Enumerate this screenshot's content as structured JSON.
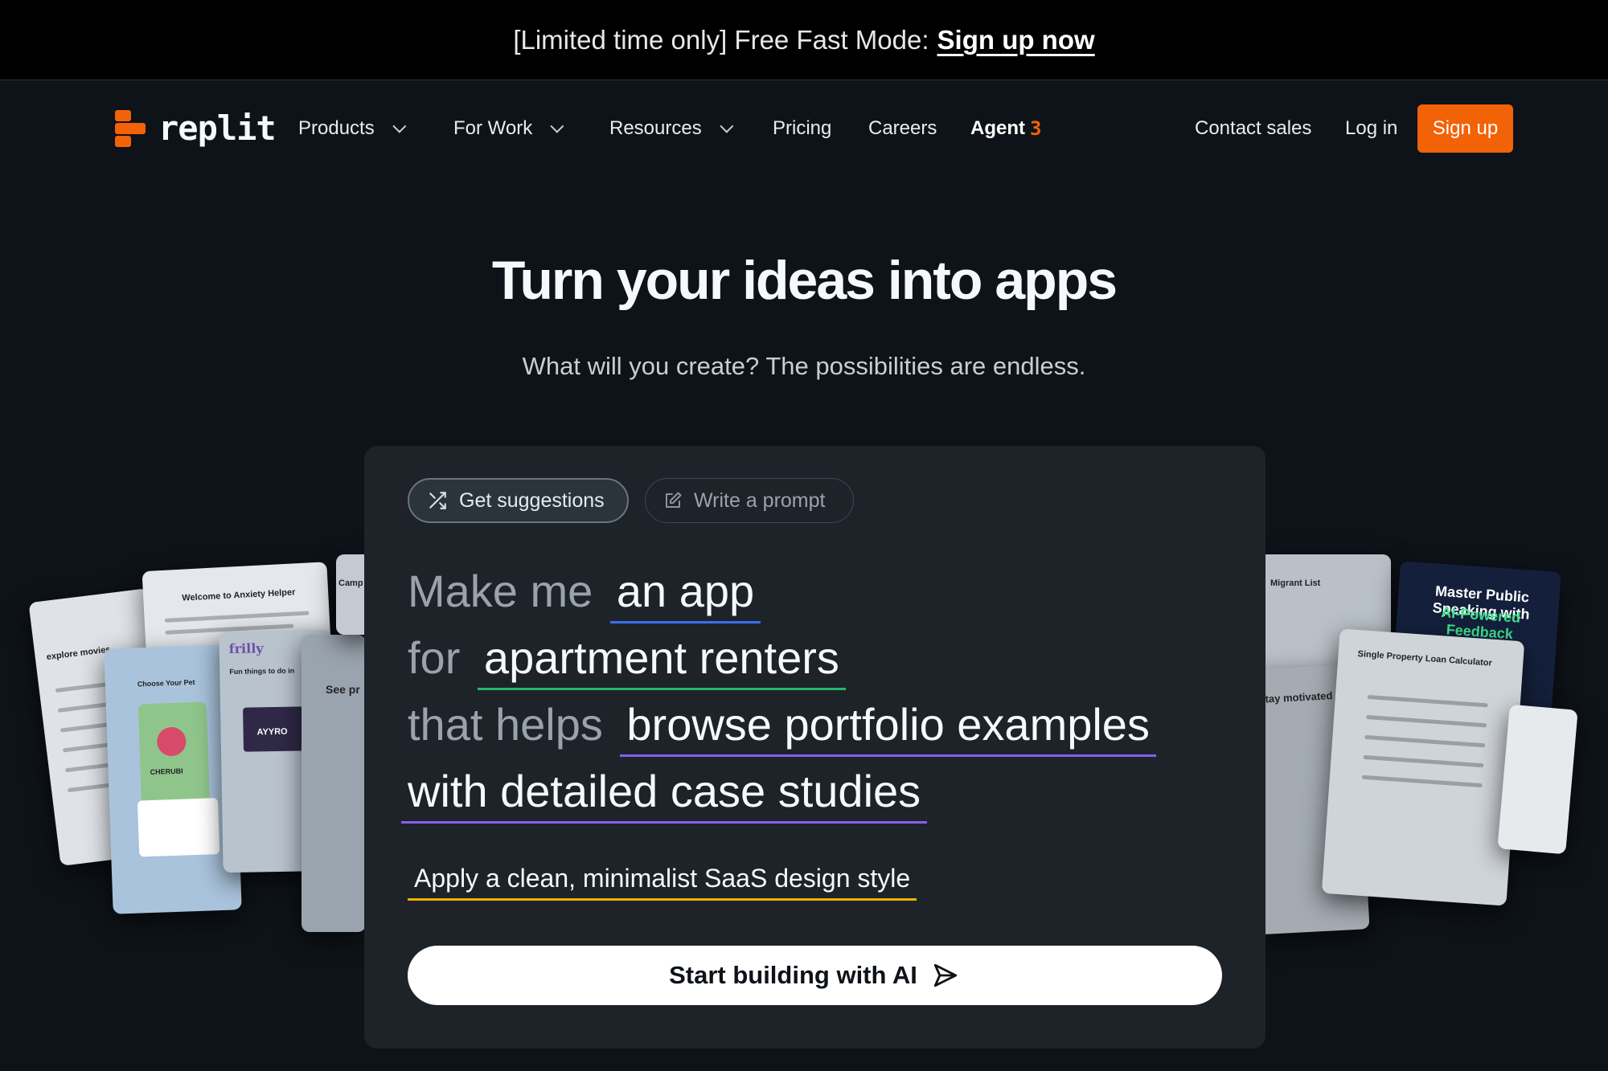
{
  "banner": {
    "text": "[Limited time only] Free Fast Mode:",
    "link": "Sign up now"
  },
  "nav": {
    "logo": "replit",
    "items": [
      {
        "label": "Products",
        "dropdown": true
      },
      {
        "label": "For Work",
        "dropdown": true
      },
      {
        "label": "Resources",
        "dropdown": true
      },
      {
        "label": "Pricing",
        "dropdown": false
      },
      {
        "label": "Careers",
        "dropdown": false
      }
    ],
    "agent": {
      "label": "Agent",
      "num": "3"
    },
    "contact_sales": "Contact sales",
    "login": "Log in",
    "signup": "Sign up"
  },
  "hero": {
    "title": "Turn your ideas into apps",
    "subtitle": "What will you create? The possibilities are endless."
  },
  "prompt_card": {
    "tabs": {
      "suggestions": "Get suggestions",
      "write": "Write a prompt"
    },
    "line1": {
      "prefix": "Make me",
      "chip": "an app"
    },
    "line2": {
      "prefix": "for",
      "chip": "apartment renters"
    },
    "line3": {
      "prefix": "that helps",
      "chip": "browse portfolio examples"
    },
    "line4": {
      "chip": "with detailed case studies"
    },
    "style": "Apply a clean, minimalist SaaS design style",
    "cta": "Start building with AI"
  },
  "deco_cards": {
    "left": [
      "explore movies",
      "Welcome to Anxiety Helper",
      "frilly",
      "Choose Your Pet",
      "CHERUBI",
      "AYYRO",
      "Fun things to do in",
      "See pr",
      "Camp"
    ],
    "right": [
      "Master Public Speaking with",
      "AI-Powered Feedback",
      "Single Property Loan Calculator",
      "stay motivated",
      "Migrant List"
    ]
  },
  "colors": {
    "accent": "#f26207",
    "chip_blue": "#3b6df5",
    "chip_green": "#25b86b",
    "chip_purple": "#8b5cf6",
    "chip_yellow": "#f0b100"
  }
}
